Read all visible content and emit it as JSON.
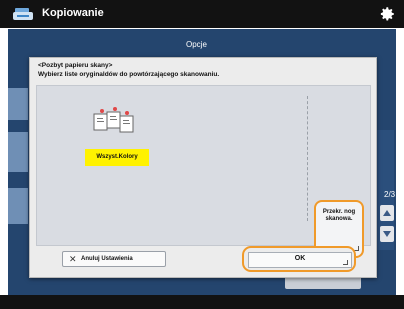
{
  "header": {
    "title": "Kopiowanie",
    "app_icon": "copy-app-icon",
    "settings_icon": "gear-icon"
  },
  "background": {
    "tab_label": "Opcje",
    "page_counter": "2/3"
  },
  "dialog": {
    "title": "<Pozbyt papieru skany>",
    "subtitle": "Wybierz liste oryginaldów do powtórzającego skanowaniu.",
    "option_all_colors": "Wszyst.Kolory",
    "next_scan_label": "Przekr. nog skanowa.",
    "cancel_label": "Anuluj Ustawienia",
    "ok_label": "OK"
  },
  "colors": {
    "selected_yellow": "#fff200",
    "focus_orange": "#f09a2a",
    "screen_blue": "#24456e"
  }
}
